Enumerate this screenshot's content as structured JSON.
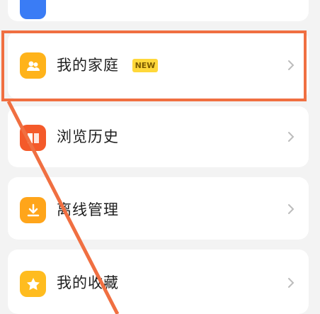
{
  "menu": {
    "items": [
      {
        "id": "family",
        "label": "我的家庭",
        "badge": "NEW",
        "icon": "family-icon",
        "icon_color": "#ffb31a"
      },
      {
        "id": "history",
        "label": "浏览历史",
        "icon": "book-icon",
        "icon_color": "#f45a2a"
      },
      {
        "id": "offline",
        "label": "离线管理",
        "icon": "download-icon",
        "icon_color": "#ffa51a"
      },
      {
        "id": "favorites",
        "label": "我的收藏",
        "icon": "star-icon",
        "icon_color": "#ffbc1f"
      }
    ]
  },
  "annotation": {
    "color": "#f06f41"
  }
}
